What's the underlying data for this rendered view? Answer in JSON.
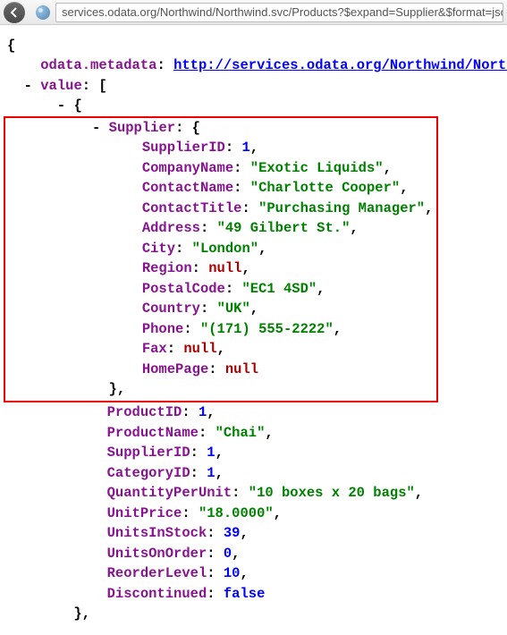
{
  "toolbar": {
    "url": "services.odata.org/Northwind/Northwind.svc/Products?$expand=Supplier&$format=jso"
  },
  "json": {
    "metadata_key": "odata.metadata",
    "metadata_link": "http://services.odata.org/Northwind/North",
    "value_key": "value",
    "supplier_key": "Supplier",
    "supplier": {
      "SupplierID": "1",
      "CompanyName": "\"Exotic Liquids\"",
      "ContactName": "\"Charlotte Cooper\"",
      "ContactTitle": "\"Purchasing Manager\"",
      "Address": "\"49 Gilbert St.\"",
      "City": "\"London\"",
      "Region": "null",
      "PostalCode": "\"EC1 4SD\"",
      "Country": "\"UK\"",
      "Phone": "\"(171) 555-2222\"",
      "Fax": "null",
      "HomePage": "null"
    },
    "product": {
      "ProductID": "1",
      "ProductName": "\"Chai\"",
      "SupplierID": "1",
      "CategoryID": "1",
      "QuantityPerUnit": "\"10 boxes x 20 bags\"",
      "UnitPrice": "\"18.0000\"",
      "UnitsInStock": "39",
      "UnitsOnOrder": "0",
      "ReorderLevel": "10",
      "Discontinued": "false"
    }
  }
}
